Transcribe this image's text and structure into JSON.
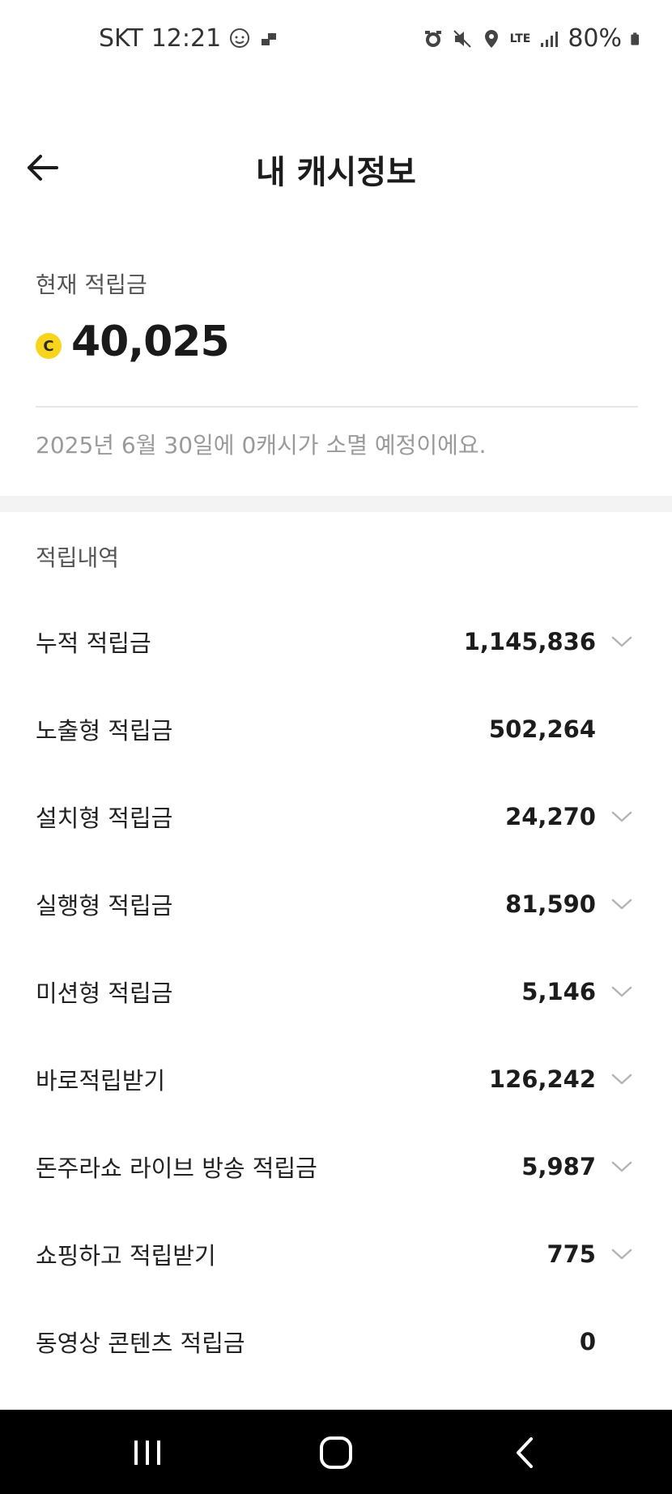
{
  "status_bar": {
    "carrier": "SKT",
    "time": "12:21",
    "network": "LTE",
    "battery": "80%"
  },
  "header": {
    "title": "내 캐시정보"
  },
  "balance": {
    "label": "현재 적립금",
    "coin_symbol": "C",
    "amount": "40,025",
    "coin_color": "#F8D41C"
  },
  "expiry_notice": "2025년 6월 30일에 0캐시가 소멸 예정이에요.",
  "history": {
    "title": "적립내역",
    "items": [
      {
        "label": "누적 적립금",
        "value": "1,145,836",
        "expandable": true
      },
      {
        "label": "노출형 적립금",
        "value": "502,264",
        "expandable": false
      },
      {
        "label": "설치형 적립금",
        "value": "24,270",
        "expandable": true
      },
      {
        "label": "실행형 적립금",
        "value": "81,590",
        "expandable": true
      },
      {
        "label": "미션형 적립금",
        "value": "5,146",
        "expandable": true
      },
      {
        "label": "바로적립받기",
        "value": "126,242",
        "expandable": true
      },
      {
        "label": "돈주라쇼 라이브 방송 적립금",
        "value": "5,987",
        "expandable": true
      },
      {
        "label": "쇼핑하고 적립받기",
        "value": "775",
        "expandable": true
      },
      {
        "label": "동영상 콘텐츠 적립금",
        "value": "0",
        "expandable": false
      }
    ]
  },
  "nav_bar": {
    "buttons": [
      "recent-apps-icon",
      "home-icon",
      "back-icon"
    ]
  }
}
